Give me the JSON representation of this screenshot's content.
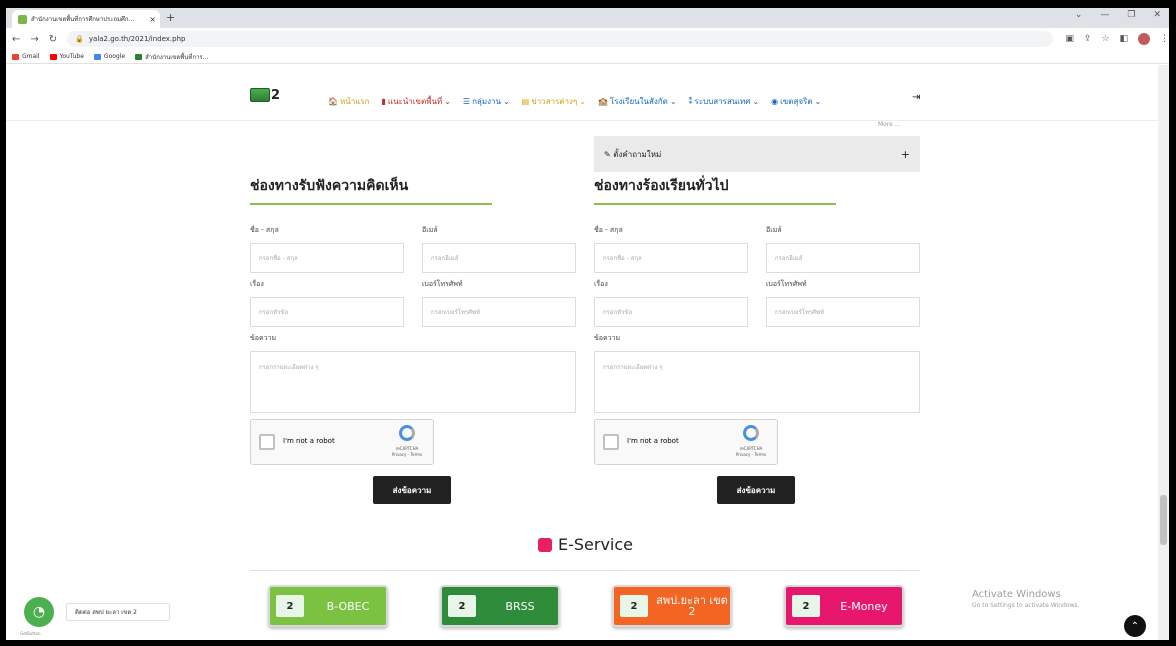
{
  "browser": {
    "tab_title": "สำนักงานเขตพื้นที่การศึกษาประถมศึก...",
    "tab_close": "×",
    "new_tab": "+",
    "url": "yala2.go.th/2021/index.php",
    "bookmarks": [
      {
        "label": "Gmail",
        "color": "#ea4335"
      },
      {
        "label": "YouTube",
        "color": "#ff0000"
      },
      {
        "label": "Google",
        "color": "#4285f4"
      },
      {
        "label": "สำนักงานเขตพื้นที่การ...",
        "color": "#2e7d32"
      }
    ]
  },
  "nav": {
    "logo_num": "2",
    "items": [
      {
        "icon": "home-icon",
        "label": "หน้าแรก",
        "color": "#d4a017"
      },
      {
        "icon": "bookmark-icon",
        "label": "แนะนำเขตพื้นที่",
        "color": "#c62828"
      },
      {
        "icon": "list-icon",
        "label": "กลุ่มงาน",
        "color": "#1565c0"
      },
      {
        "icon": "news-icon",
        "label": "ข่าวสารต่างๆ",
        "color": "#d4a017"
      },
      {
        "icon": "school-icon",
        "label": "โรงเรียนในสังกัด",
        "color": "#1565c0"
      },
      {
        "icon": "network-icon",
        "label": "ระบบสารสนเทศ",
        "color": "#1565c0"
      },
      {
        "icon": "globe-icon",
        "label": "เขตสุจริต",
        "color": "#1565c0"
      }
    ]
  },
  "more_label": "More ...",
  "new_question": {
    "label": "ตั้งคำถามใหม่",
    "plus": "+"
  },
  "forms": [
    {
      "title": "ช่องทางรับฟังความคิดเห็น",
      "name_label": "ชื่อ - สกุล",
      "name_placeholder": "กรอกชื่อ - สกุล",
      "email_label": "อีเมล์",
      "email_placeholder": "กรอกอีเมล์",
      "subject_label": "เรื่อง",
      "subject_placeholder": "กรอกหัวข้อ",
      "phone_label": "เบอร์โทรศัพท์",
      "phone_placeholder": "กรอกเบอร์โทรศัพท์",
      "message_label": "ข้อความ",
      "message_placeholder": "กรอกรายละเอียดต่าง ๆ",
      "captcha_text": "I'm not a robot",
      "captcha_brand": "reCAPTCHA",
      "captcha_links": "Privacy - Terms",
      "submit": "ส่งข้อความ"
    },
    {
      "title": "ช่องทางร้องเรียนทั่วไป",
      "name_label": "ชื่อ - สกุล",
      "name_placeholder": "กรอกชื่อ - สกุล",
      "email_label": "อีเมล์",
      "email_placeholder": "กรอกอีเมล์",
      "subject_label": "เรื่อง",
      "subject_placeholder": "กรอกหัวข้อ",
      "phone_label": "เบอร์โทรศัพท์",
      "phone_placeholder": "กรอกเบอร์โทรศัพท์",
      "message_label": "ข้อความ",
      "message_placeholder": "กรอกรายละเอียดต่าง ๆ",
      "captcha_text": "I'm not a robot",
      "captcha_brand": "reCAPTCHA",
      "captcha_links": "Privacy - Terms",
      "submit": "ส่งข้อความ"
    }
  ],
  "eservice": {
    "title": "E-Service",
    "badges": [
      {
        "num": "2",
        "label": "B-OBEC",
        "color": "#7cc242"
      },
      {
        "num": "2",
        "label": "BRSS",
        "color": "#2e8b3a"
      },
      {
        "num": "2",
        "label": "สพป.ยะลา เขต 2",
        "color": "#f26522"
      },
      {
        "num": "2",
        "label": "E-Money",
        "color": "#e6176d"
      }
    ]
  },
  "chat": {
    "label": "ติดต่อ สพป ยะลา เขต 2",
    "brand": "GetButton"
  },
  "activate": {
    "line1": "Activate Windows",
    "line2": "Go to Settings to activate Windows."
  }
}
